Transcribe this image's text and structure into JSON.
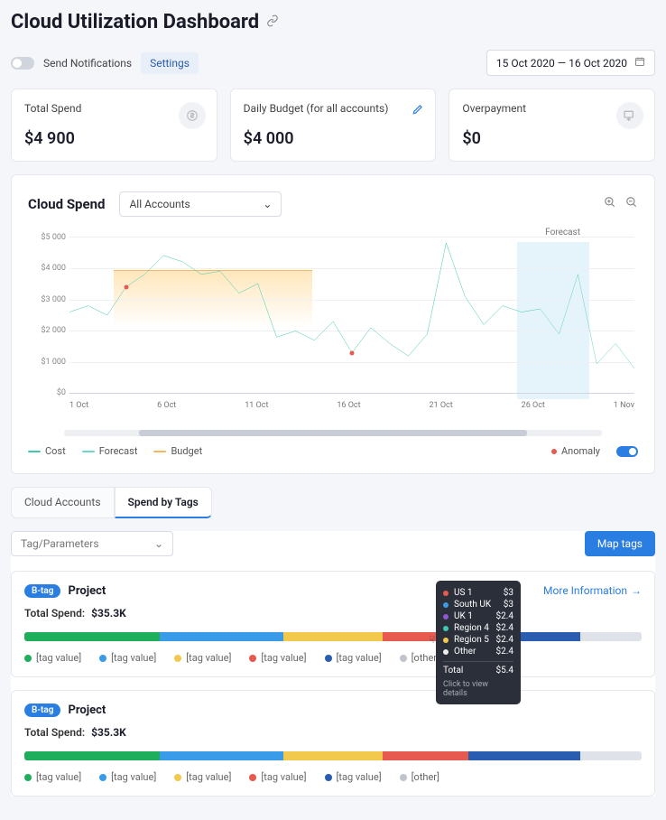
{
  "page": {
    "title": "Cloud Utilization Dashboard",
    "notifications_label": "Send Notifications",
    "settings_label": "Settings",
    "date_range": "15 Oct 2020 — 16 Oct 2020"
  },
  "cards": {
    "total_spend": {
      "title": "Total Spend",
      "value": "$4 900"
    },
    "daily_budget": {
      "title": "Daily Budget (for all accounts)",
      "value": "$4 000"
    },
    "overpayment": {
      "title": "Overpayment",
      "value": "$0"
    }
  },
  "spend_panel": {
    "title": "Cloud Spend",
    "account_select": "All Accounts",
    "forecast_label": "Forecast",
    "legend": {
      "cost": "Cost",
      "forecast": "Forecast",
      "budget": "Budget",
      "anomaly": "Anomaly"
    }
  },
  "tabs": {
    "accounts": "Cloud Accounts",
    "spend_by_tags": "Spend by Tags"
  },
  "tags_section": {
    "param_select": "Tag/Parameters",
    "map_tags": "Map tags",
    "more_info": "More Information"
  },
  "projects": [
    {
      "tag": "B-tag",
      "name": "Project",
      "total_label": "Total Spend:",
      "total_value": "$35.3K"
    },
    {
      "tag": "B-tag",
      "name": "Project",
      "total_label": "Total Spend:",
      "total_value": "$35.3K"
    }
  ],
  "project_legend": {
    "items": [
      "[tag value]",
      "[tag value]",
      "[tag value]",
      "[tag value]",
      "[tag value]",
      "[other]"
    ],
    "colors": [
      "#1fae5c",
      "#3a9ce8",
      "#f2c94c",
      "#e65a4f",
      "#2a5db0",
      "#c0c4cc"
    ]
  },
  "tooltip": {
    "rows": [
      {
        "name": "US 1",
        "value": "$3",
        "color": "#e65a4f"
      },
      {
        "name": "South UK",
        "value": "$3",
        "color": "#3a9ce8"
      },
      {
        "name": "UK 1",
        "value": "$2.4",
        "color": "#9257d6"
      },
      {
        "name": "Region 4",
        "value": "$2.4",
        "color": "#3fc9b0"
      },
      {
        "name": "Region 5",
        "value": "$2.4",
        "color": "#f2c94c"
      },
      {
        "name": "Other",
        "value": "$2.4",
        "color": "#ededed"
      }
    ],
    "total_label": "Total",
    "total_value": "$5.4",
    "footer": "Click to view details"
  },
  "chart_data": {
    "type": "line",
    "title": "Cloud Spend",
    "xlabel": "",
    "ylabel": "",
    "ylim": [
      0,
      5000
    ],
    "y_ticks": [
      "$5 000",
      "$4 000",
      "$3 000",
      "$2 000",
      "$1 000",
      "$0"
    ],
    "x_ticks": [
      "1 Oct",
      "6 Oct",
      "11 Oct",
      "16 Oct",
      "21 Oct",
      "26 Oct",
      "1 Nov"
    ],
    "categories": [
      "1 Oct",
      "2 Oct",
      "3 Oct",
      "4 Oct",
      "5 Oct",
      "6 Oct",
      "7 Oct",
      "8 Oct",
      "9 Oct",
      "10 Oct",
      "11 Oct",
      "12 Oct",
      "13 Oct",
      "14 Oct",
      "15 Oct",
      "16 Oct",
      "17 Oct",
      "18 Oct",
      "19 Oct",
      "20 Oct",
      "21 Oct",
      "22 Oct",
      "23 Oct",
      "24 Oct",
      "25 Oct",
      "26 Oct",
      "27 Oct",
      "28 Oct",
      "29 Oct",
      "30 Oct",
      "1 Nov"
    ],
    "series": [
      {
        "name": "Cost",
        "color": "#3fc9b0",
        "values": [
          2600,
          2800,
          2500,
          3400,
          3800,
          4400,
          4200,
          3800,
          3900,
          3200,
          3500,
          1800,
          2000,
          1700,
          2300,
          1300,
          2100,
          1600,
          1200,
          1900,
          4800,
          3100,
          2200,
          2800,
          2600,
          2700,
          null,
          null,
          null,
          null,
          null
        ]
      },
      {
        "name": "Forecast",
        "color": "#3fc9b0",
        "values": [
          null,
          null,
          null,
          null,
          null,
          null,
          null,
          null,
          null,
          null,
          null,
          null,
          null,
          null,
          null,
          null,
          null,
          null,
          null,
          null,
          null,
          null,
          null,
          null,
          null,
          2700,
          1900,
          3800,
          950,
          1600,
          800
        ]
      }
    ],
    "budget_line": {
      "name": "Budget",
      "color": "#f0b95c",
      "value": 3500,
      "range": [
        "1 Oct",
        "11 Oct"
      ]
    },
    "forecast_band": [
      "26 Oct",
      "1 Nov"
    ],
    "anomalies": [
      "4 Oct",
      "16 Oct"
    ],
    "legend_items": [
      "Cost",
      "Forecast",
      "Budget",
      "Anomaly"
    ]
  },
  "chart_data_tags": [
    {
      "type": "bar",
      "title": "Project",
      "total_label": "Total Spend:",
      "total_value": "$35.3K",
      "orientation": "stacked-horizontal",
      "segments": [
        {
          "name": "[tag value]",
          "color": "#1fae5c",
          "pct": 22
        },
        {
          "name": "[tag value]",
          "color": "#3a9ce8",
          "pct": 20
        },
        {
          "name": "[tag value]",
          "color": "#f2c94c",
          "pct": 16
        },
        {
          "name": "[tag value]",
          "color": "#e65a4f",
          "pct": 14
        },
        {
          "name": "[tag value]",
          "color": "#2a5db0",
          "pct": 18
        },
        {
          "name": "[other]",
          "color": "#dfe2e8",
          "pct": 10
        }
      ]
    },
    {
      "type": "bar",
      "title": "Project",
      "total_label": "Total Spend:",
      "total_value": "$35.3K",
      "orientation": "stacked-horizontal",
      "segments": [
        {
          "name": "[tag value]",
          "color": "#1fae5c",
          "pct": 22
        },
        {
          "name": "[tag value]",
          "color": "#3a9ce8",
          "pct": 20
        },
        {
          "name": "[tag value]",
          "color": "#f2c94c",
          "pct": 16
        },
        {
          "name": "[tag value]",
          "color": "#e65a4f",
          "pct": 14
        },
        {
          "name": "[tag value]",
          "color": "#2a5db0",
          "pct": 18
        },
        {
          "name": "[other]",
          "color": "#dfe2e8",
          "pct": 10
        }
      ]
    }
  ]
}
